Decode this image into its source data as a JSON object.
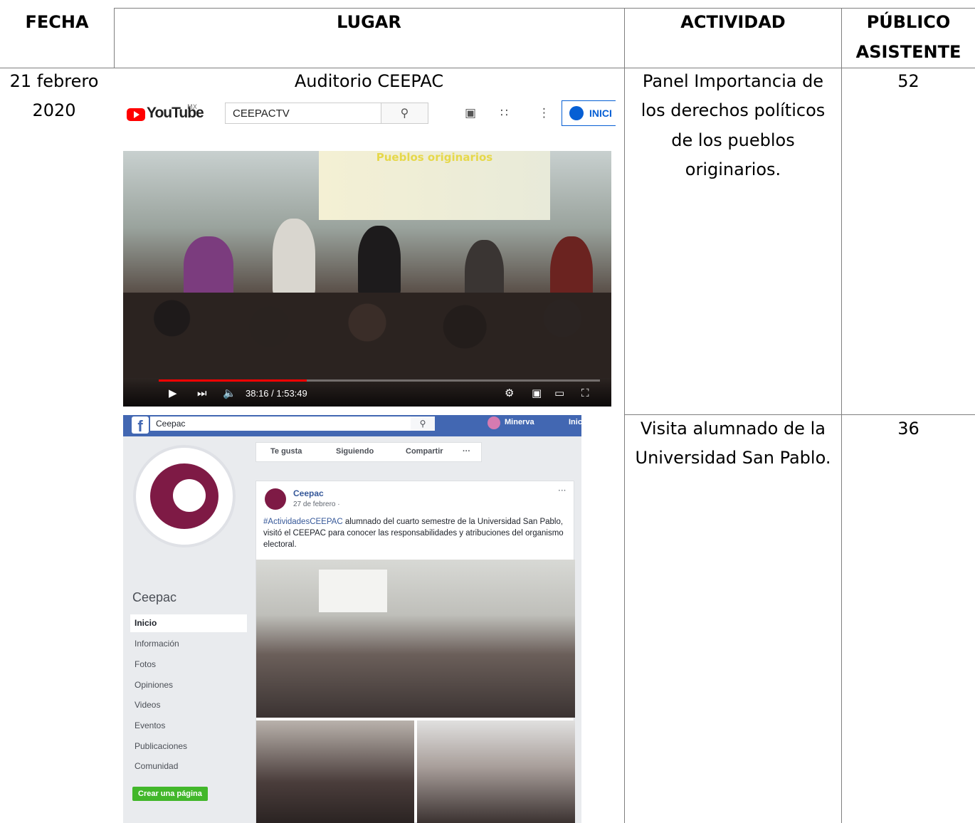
{
  "table": {
    "headers": {
      "fecha": "FECHA",
      "lugar": "LUGAR",
      "actividad": "ACTIVIDAD",
      "publico_line1": "PÚBLICO",
      "publico_line2": "ASISTENTE"
    },
    "row1": {
      "fecha_line1": "21 febrero",
      "fecha_line2": "2020",
      "lugar": "Auditorio CEEPAC",
      "actividad_lines": [
        "Panel Importancia de",
        "los derechos políticos",
        "de los pueblos",
        "originarios."
      ],
      "publico": "52"
    },
    "row2": {
      "actividad_lines": [
        "Visita alumnado de la",
        "Universidad San Pablo."
      ],
      "publico": "36"
    }
  },
  "youtube": {
    "logo_text": "YouTube",
    "region": "MX",
    "search_value": "CEEPACTV",
    "signin_label": "INICI",
    "screen_title": "Pueblos originarios",
    "time": "38:16 / 1:53:49",
    "progress_fraction": 0.336,
    "icons": [
      "search-icon",
      "video-camera-icon",
      "apps-grid-icon",
      "more-vert-icon",
      "account-icon",
      "play-icon",
      "next-icon",
      "volume-icon",
      "settings-icon",
      "miniplayer-icon",
      "theater-icon",
      "fullscreen-icon"
    ]
  },
  "facebook": {
    "search_value": "Ceepac",
    "user": "Minerva",
    "home": "Inic",
    "page_name": "Ceepac",
    "nav": [
      "Inicio",
      "Información",
      "Fotos",
      "Opiniones",
      "Videos",
      "Eventos",
      "Publicaciones",
      "Comunidad"
    ],
    "create_page": "Crear una página",
    "actions": [
      "Te gusta",
      "Siguiendo",
      "Compartir",
      "···"
    ],
    "post": {
      "author": "Ceepac",
      "date": "27 de febrero ·",
      "hashtag": "#ActividadesCEEPAC",
      "text": " alumnado del cuarto semestre de la Universidad San Pablo, visitó el CEEPAC para conocer las responsabilidades y atribuciones del organismo electoral.",
      "more": "···"
    }
  }
}
